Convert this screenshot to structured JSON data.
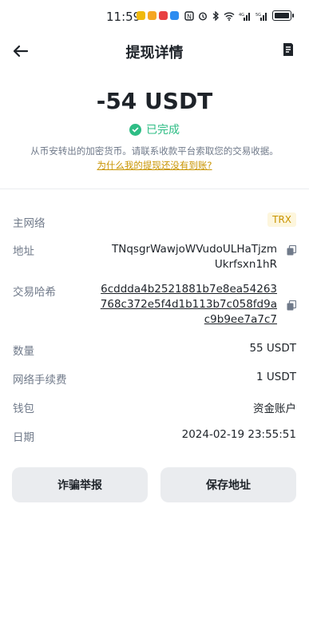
{
  "status_bar": {
    "time": "11:59"
  },
  "header": {
    "title": "提现详情"
  },
  "summary": {
    "amount": "-54 USDT",
    "status": "已完成",
    "notice": "从币安转出的加密货币。请联系收款平台索取您的交易收据。",
    "help_link": "为什么我的提现还没有到账?"
  },
  "details": {
    "network": {
      "label": "主网络",
      "value": "TRX"
    },
    "address": {
      "label": "地址",
      "lines": [
        "TNqsgrWawjoWVudoULHaTjzm",
        "Ukrfsxn1hR"
      ]
    },
    "txhash": {
      "label": "交易哈希",
      "lines": [
        "6cddda4b2521881b7e8ea54263",
        "768c372e5f4d1b113b7c058fd9a",
        "c9b9ee7a7c7"
      ]
    },
    "amount": {
      "label": "数量",
      "value": "55 USDT"
    },
    "fee": {
      "label": "网络手续费",
      "value": "1 USDT"
    },
    "wallet": {
      "label": "钱包",
      "value": "资金账户"
    },
    "date": {
      "label": "日期",
      "value": "2024-02-19 23:55:51"
    }
  },
  "actions": {
    "report": "诈骗举报",
    "save_address": "保存地址"
  },
  "colors": {
    "success": "#2ebd85",
    "link": "#c99400",
    "badge_bg": "#fdf6dd"
  }
}
